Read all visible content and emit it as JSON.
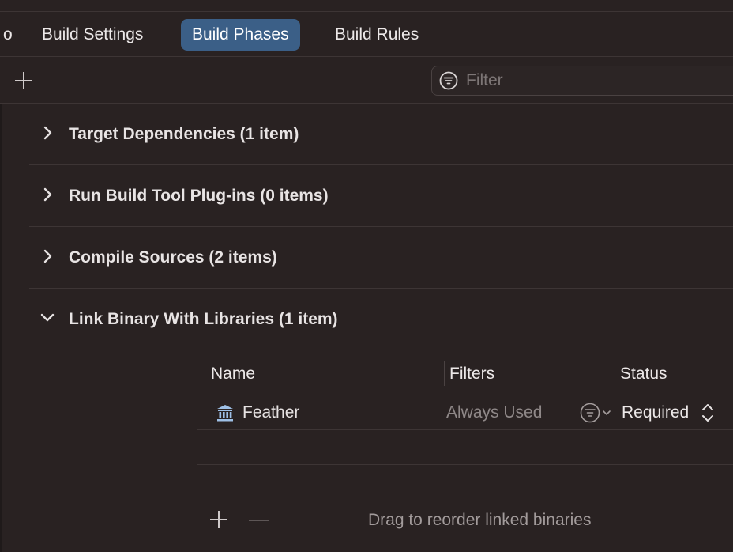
{
  "tabs": [
    {
      "label": "o"
    },
    {
      "label": "Build Settings"
    },
    {
      "label": "Build Phases",
      "active": true
    },
    {
      "label": "Build Rules"
    }
  ],
  "toolbar": {
    "add_icon": "plus-icon",
    "filter_placeholder": "Filter",
    "filter_icon": "filter-icon"
  },
  "phases": [
    {
      "title": "Target Dependencies (1 item)",
      "expanded": false
    },
    {
      "title": "Run Build Tool Plug-ins (0 items)",
      "expanded": false
    },
    {
      "title": "Compile Sources (2 items)",
      "expanded": false
    },
    {
      "title": "Link Binary With Libraries (1 item)",
      "expanded": true
    }
  ],
  "library_table": {
    "columns": [
      "Name",
      "Filters",
      "Status"
    ],
    "rows": [
      {
        "name": "Feather",
        "filters": "Always Used",
        "status": "Required",
        "icon": "library-icon"
      }
    ],
    "footer_hint": "Drag to reorder linked binaries"
  },
  "colors": {
    "background": "#292222",
    "active_tab": "#3b5f87",
    "divider": "#3d3535",
    "secondary_text": "#8f8888"
  }
}
